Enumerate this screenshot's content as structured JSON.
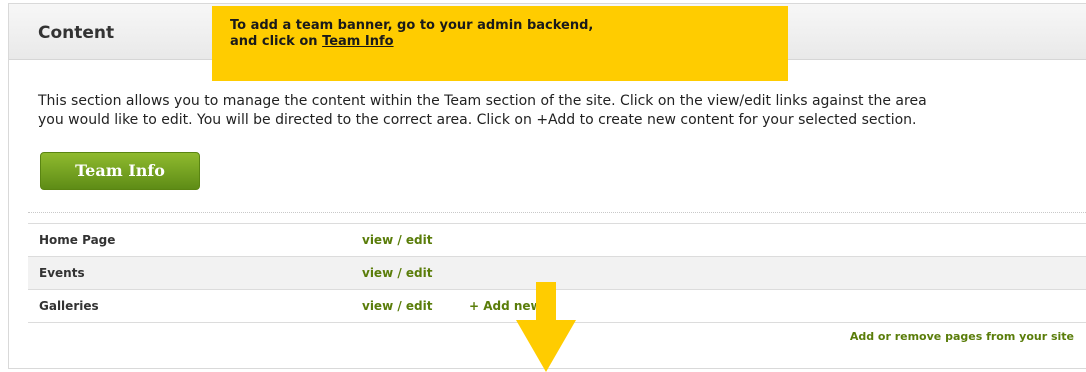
{
  "panel": {
    "title": "Content"
  },
  "callout": {
    "line1": "To add a team banner, go to your admin backend,",
    "line2_prefix": "and click on ",
    "line2_link": "Team Info",
    "color": "#ffcc00"
  },
  "intro": {
    "line1": "This section allows you to manage the content within the Team section of the site. Click on the view/edit links against the area",
    "line2": "you would like to edit. You will be directed to the correct area. Click on +Add to create new content for your selected section."
  },
  "team_info_button": {
    "label": "Team Info",
    "color": "#6f9c1e"
  },
  "pages": [
    {
      "name": "Home Page",
      "view_edit": "view / edit",
      "add_new": ""
    },
    {
      "name": "Events",
      "view_edit": "view / edit",
      "add_new": ""
    },
    {
      "name": "Galleries",
      "view_edit": "view / edit",
      "add_new": "+ Add new"
    }
  ],
  "bottom_link": "Add or remove pages from your site",
  "accent_link_color": "#5a7d0a",
  "arrow": {
    "icon": "down-arrow-icon",
    "color": "#ffcc00"
  }
}
